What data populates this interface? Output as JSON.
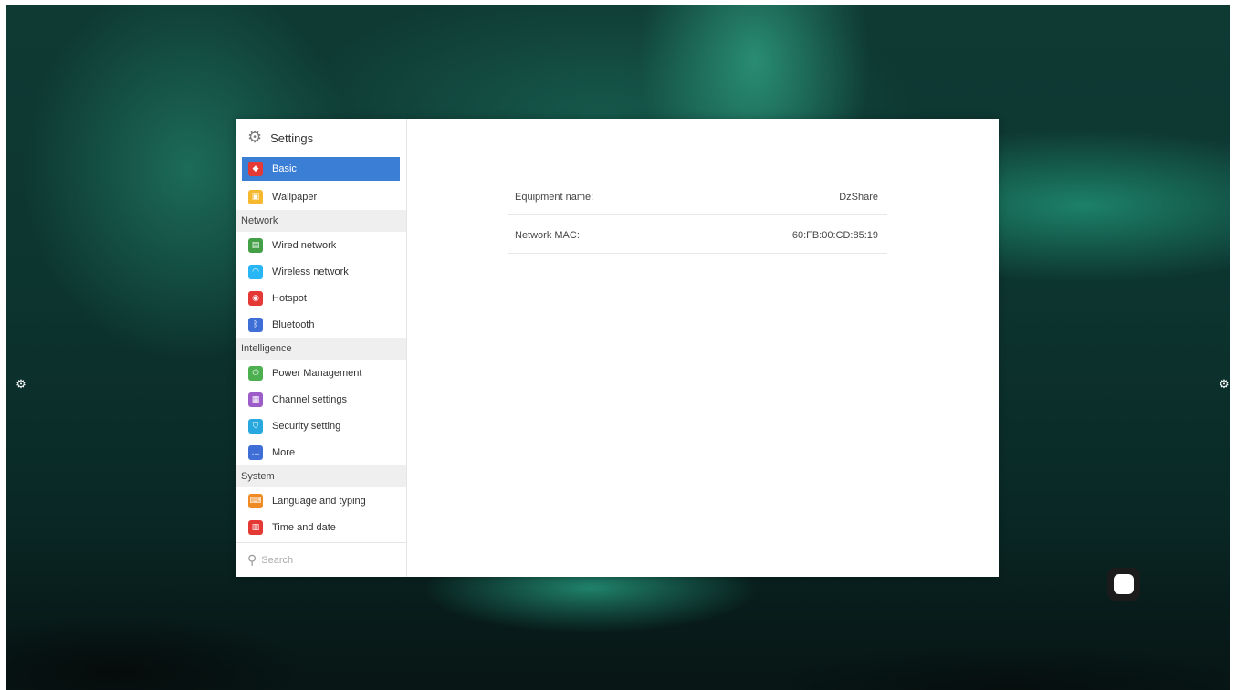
{
  "window": {
    "title": "Settings",
    "title_icon": "gear-icon"
  },
  "sidebar": {
    "groups": [
      {
        "section": "",
        "items": [
          {
            "label": "Basic",
            "icon": "basic-icon",
            "color": "#e53935",
            "active": true
          },
          {
            "label": "Wallpaper",
            "icon": "wallpaper-icon",
            "color": "#f5b82e",
            "active": false
          }
        ]
      },
      {
        "section": "Network",
        "items": [
          {
            "label": "Wired network",
            "icon": "wired-network-icon",
            "color": "#43a047",
            "active": false
          },
          {
            "label": "Wireless network",
            "icon": "wifi-icon",
            "color": "#29b6f6",
            "active": false
          },
          {
            "label": "Hotspot",
            "icon": "hotspot-icon",
            "color": "#e53935",
            "active": false
          },
          {
            "label": "Bluetooth",
            "icon": "bluetooth-icon",
            "color": "#3f6fd6",
            "active": false
          }
        ]
      },
      {
        "section": "Intelligence",
        "items": [
          {
            "label": "Power Management",
            "icon": "power-icon",
            "color": "#4caf50",
            "active": false
          },
          {
            "label": "Channel settings",
            "icon": "channel-icon",
            "color": "#9c5dc8",
            "active": false
          },
          {
            "label": "Security setting",
            "icon": "security-icon",
            "color": "#29a8e0",
            "active": false
          },
          {
            "label": "More",
            "icon": "more-icon",
            "color": "#3f6fd6",
            "active": false
          }
        ]
      },
      {
        "section": "System",
        "items": [
          {
            "label": "Language and typing",
            "icon": "language-icon",
            "color": "#f08a24",
            "active": false
          },
          {
            "label": "Time and date",
            "icon": "calendar-icon",
            "color": "#e53935",
            "active": false
          }
        ]
      }
    ],
    "search_placeholder": "Search"
  },
  "content": {
    "equipment_name_label": "Equipment name:",
    "equipment_name_value": "DzShare",
    "network_mac_label": "Network MAC:",
    "network_mac_value": "60:FB:00:CD:85:19"
  },
  "colors": {
    "accent": "#3b7ed6",
    "section_bg": "#efefef"
  }
}
